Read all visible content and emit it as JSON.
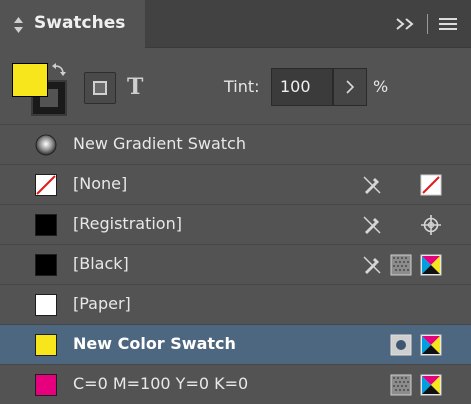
{
  "panel": {
    "title": "Swatches"
  },
  "toolbar": {
    "tint_label": "Tint:",
    "tint_value": "100",
    "tint_unit": "%",
    "fill_color": "#f7e61b",
    "text_icon_glyph": "T"
  },
  "swatches": [
    {
      "label": "New Gradient Swatch",
      "chip": "gradient-icon"
    },
    {
      "label": "[None]",
      "chip": "none",
      "icons": [
        "no-edit-icon",
        "none-type-icon"
      ]
    },
    {
      "label": "[Registration]",
      "chip": "#000000",
      "icons": [
        "no-edit-icon",
        "registration-icon"
      ]
    },
    {
      "label": "[Black]",
      "chip": "#000000",
      "icons": [
        "no-edit-icon",
        "process-icon",
        "cmyk-icon"
      ]
    },
    {
      "label": "[Paper]",
      "chip": "#ffffff"
    },
    {
      "label": "New Color Swatch",
      "chip": "#f7e61b",
      "selected": true,
      "icons": [
        "spot-icon",
        "cmyk-icon"
      ]
    },
    {
      "label": "C=0 M=100 Y=0 K=0",
      "chip": "#e6007e",
      "icons": [
        "process-icon",
        "cmyk-icon"
      ]
    }
  ]
}
